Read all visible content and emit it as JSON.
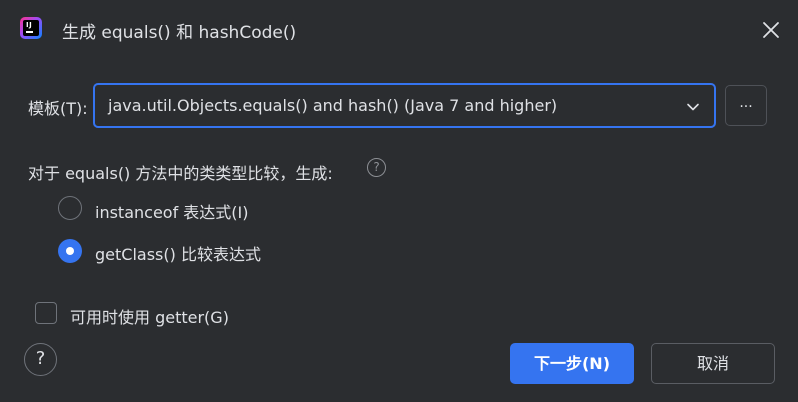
{
  "window": {
    "title": "生成 equals() 和 hashCode()",
    "app_icon": "intellij-idea-icon",
    "close_icon": "close-icon"
  },
  "template": {
    "label": "模板(T):",
    "selected_value": "java.util.Objects.equals() and hash() (Java 7 and higher)",
    "dropdown_icon": "chevron-down-icon",
    "more_button_label": "..."
  },
  "comparison": {
    "label": "对于 equals() 方法中的类类型比较，生成:",
    "help_icon_glyph": "?",
    "options": [
      {
        "label": "instanceof 表达式(I)",
        "selected": false
      },
      {
        "label": "getClass() 比较表达式",
        "selected": true
      }
    ]
  },
  "getter_option": {
    "label": "可用时使用 getter(G)",
    "checked": false
  },
  "footer": {
    "help_glyph": "?",
    "next_button": "下一步(N)",
    "cancel_button": "取消"
  },
  "colors": {
    "background": "#2b2d30",
    "accent": "#3574f0",
    "text": "#dfe1e5",
    "border": "#5a5d63"
  }
}
